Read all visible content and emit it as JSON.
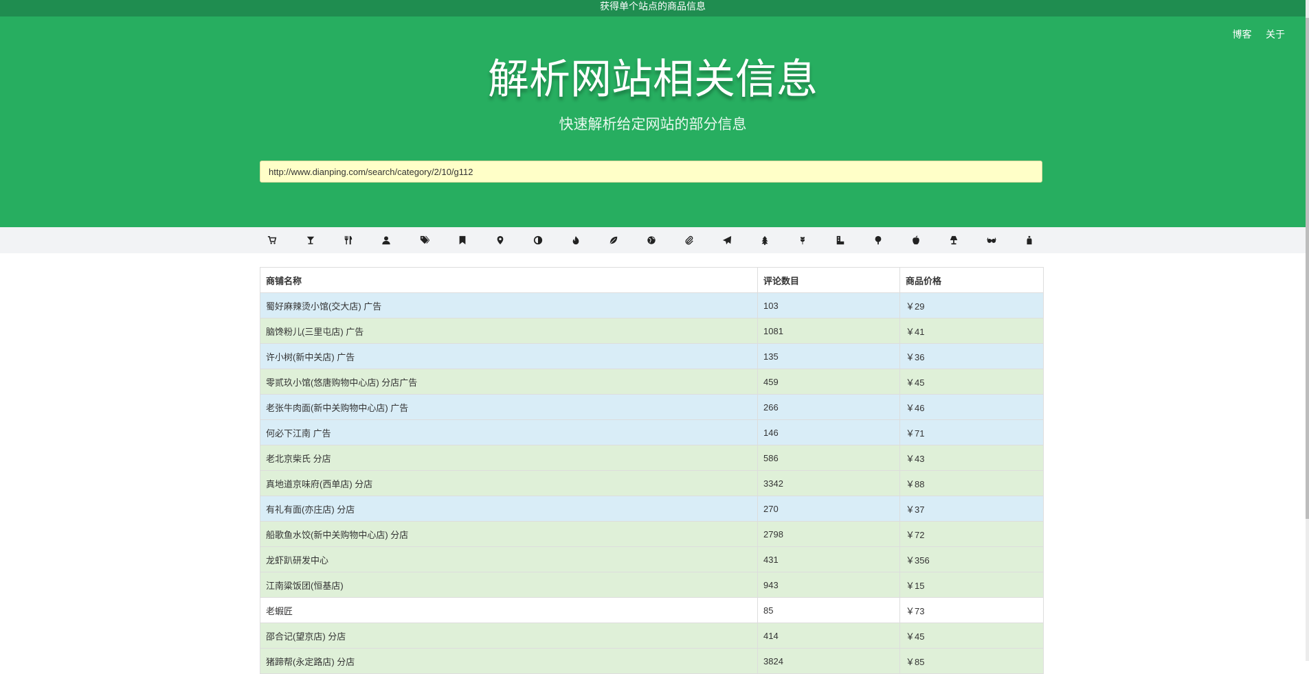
{
  "top_banner": "获得单个站点的商品信息",
  "nav": {
    "blog": "博客",
    "about": "关于"
  },
  "hero": {
    "title": "解析网站相关信息",
    "subtitle": "快速解析给定网站的部分信息"
  },
  "url_input": {
    "value": "http://www.dianping.com/search/category/2/10/g112"
  },
  "icons": [
    "shopping-cart-icon",
    "cocktail-glass-icon",
    "cutlery-icon",
    "user-icon",
    "tags-icon",
    "bookmark-icon",
    "map-marker-icon",
    "adjust-contrast-icon",
    "fire-icon",
    "leaf-icon",
    "globe-icon",
    "paperclip-icon",
    "send-icon",
    "tree-icon",
    "grain-icon",
    "office-building-icon",
    "tree-deciduous-icon",
    "apple-icon",
    "lamp-icon",
    "sunglasses-icon",
    "bottle-icon"
  ],
  "table": {
    "headers": [
      "商铺名称",
      "评论数目",
      "商品价格"
    ],
    "rows": [
      {
        "name": "蜀好麻辣烫小馆(交大店) 广告",
        "reviews": "103",
        "price": "￥29",
        "style": "info"
      },
      {
        "name": "脑馋粉儿(三里屯店) 广告",
        "reviews": "1081",
        "price": "￥41",
        "style": "success"
      },
      {
        "name": "许小树(新中关店) 广告",
        "reviews": "135",
        "price": "￥36",
        "style": "info"
      },
      {
        "name": "零贰玖小馆(悠唐购物中心店) 分店广告",
        "reviews": "459",
        "price": "￥45",
        "style": "success"
      },
      {
        "name": "老张牛肉面(新中关购物中心店) 广告",
        "reviews": "266",
        "price": "￥46",
        "style": "info"
      },
      {
        "name": "何必下江南 广告",
        "reviews": "146",
        "price": "￥71",
        "style": "info"
      },
      {
        "name": "老北京柴氏 分店",
        "reviews": "586",
        "price": "￥43",
        "style": "success"
      },
      {
        "name": "真地道京味府(西单店) 分店",
        "reviews": "3342",
        "price": "￥88",
        "style": "success"
      },
      {
        "name": "有礼有面(亦庄店) 分店",
        "reviews": "270",
        "price": "￥37",
        "style": "info"
      },
      {
        "name": "船歌鱼水饺(新中关购物中心店) 分店",
        "reviews": "2798",
        "price": "￥72",
        "style": "success"
      },
      {
        "name": "龙虾趴研发中心",
        "reviews": "431",
        "price": "￥356",
        "style": "success"
      },
      {
        "name": "江南粱饭团(恒基店)",
        "reviews": "943",
        "price": "￥15",
        "style": "success"
      },
      {
        "name": "老蝦匠",
        "reviews": "85",
        "price": "￥73",
        "style": "plain"
      },
      {
        "name": "邵合记(望京店) 分店",
        "reviews": "414",
        "price": "￥45",
        "style": "success"
      },
      {
        "name": "猪蹄帮(永定路店) 分店",
        "reviews": "3824",
        "price": "￥85",
        "style": "success"
      }
    ]
  }
}
